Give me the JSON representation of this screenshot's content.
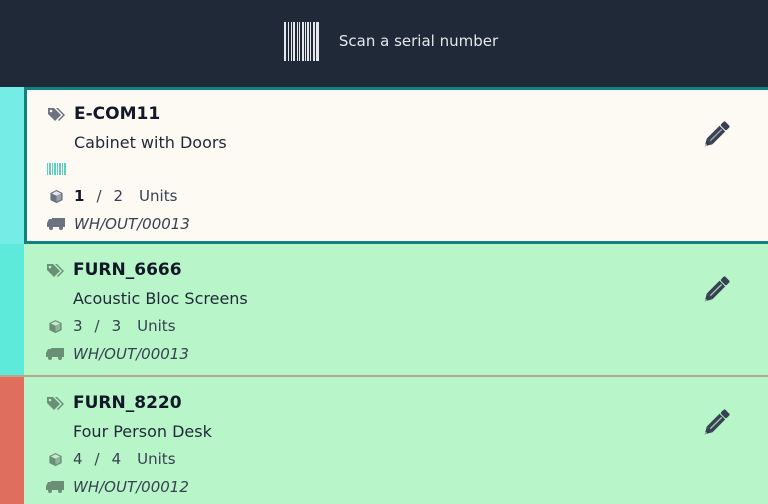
{
  "header": {
    "scan_label": "Scan a serial number",
    "icon": "barcode-icon"
  },
  "colors": {
    "header_bg": "#1f2937",
    "selected_card_bg": "#fdf9f3",
    "selected_border": "#12817f",
    "done_card_bg": "#b8f5c8",
    "stripe_cyan_selected": "#75ece6",
    "stripe_cyan": "#5eeadb",
    "stripe_red": "#e06e5e"
  },
  "lines": [
    {
      "product_ref": "E-COM11",
      "product_name": "Cabinet with Doors",
      "has_serial_barcode": true,
      "qty_done": "1",
      "qty_separator": "/",
      "qty_total": "2",
      "uom": "Units",
      "picking_ref": "WH/OUT/00013",
      "selected": true,
      "edit_icon": "pencil-icon"
    },
    {
      "product_ref": "FURN_6666",
      "product_name": "Acoustic Bloc Screens",
      "has_serial_barcode": false,
      "qty_done": "3",
      "qty_separator": "/",
      "qty_total": "3",
      "uom": "Units",
      "picking_ref": "WH/OUT/00013",
      "selected": false,
      "edit_icon": "pencil-icon"
    },
    {
      "product_ref": "FURN_8220",
      "product_name": "Four Person Desk",
      "has_serial_barcode": false,
      "qty_done": "4",
      "qty_separator": "/",
      "qty_total": "4",
      "uom": "Units",
      "picking_ref": "WH/OUT/00012",
      "selected": false,
      "edit_icon": "pencil-icon"
    }
  ]
}
